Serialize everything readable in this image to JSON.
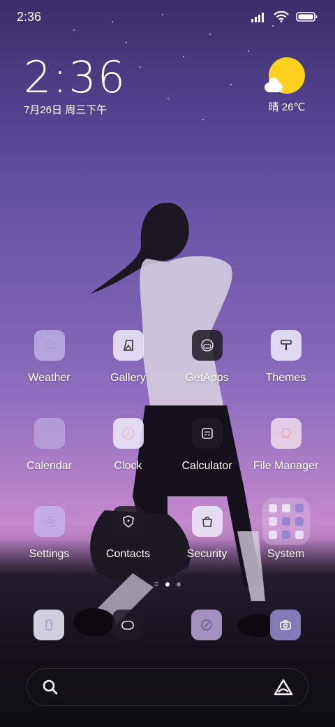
{
  "status_bar": {
    "time": "2:36"
  },
  "clock_widget": {
    "time": "2:36",
    "date": "7月26日 周三下午"
  },
  "weather_widget": {
    "text": "晴 26℃"
  },
  "apps": [
    {
      "label": "Weather",
      "icon": "cloud-icon"
    },
    {
      "label": "Gallery",
      "icon": "gallery-icon"
    },
    {
      "label": "GetApps",
      "icon": "getapps-icon"
    },
    {
      "label": "Themes",
      "icon": "paint-roller-icon"
    },
    {
      "label": "Calendar",
      "icon": "calendar-icon"
    },
    {
      "label": "Clock",
      "icon": "clock-icon"
    },
    {
      "label": "Calculator",
      "icon": "calculator-icon"
    },
    {
      "label": "File Manager",
      "icon": "folder-icon"
    },
    {
      "label": "Settings",
      "icon": "gear-icon"
    },
    {
      "label": "Contacts",
      "icon": "contacts-icon"
    },
    {
      "label": "Security",
      "icon": "security-icon"
    },
    {
      "label": "System",
      "icon": "folder-group-icon"
    }
  ],
  "dock": [
    {
      "icon": "phone-icon"
    },
    {
      "icon": "message-icon"
    },
    {
      "icon": "compass-icon"
    },
    {
      "icon": "camera-icon"
    }
  ],
  "colors": {
    "sun": "#ffd21f",
    "sky_top": "#3a2f6a",
    "sky_mid": "#9470bf"
  }
}
